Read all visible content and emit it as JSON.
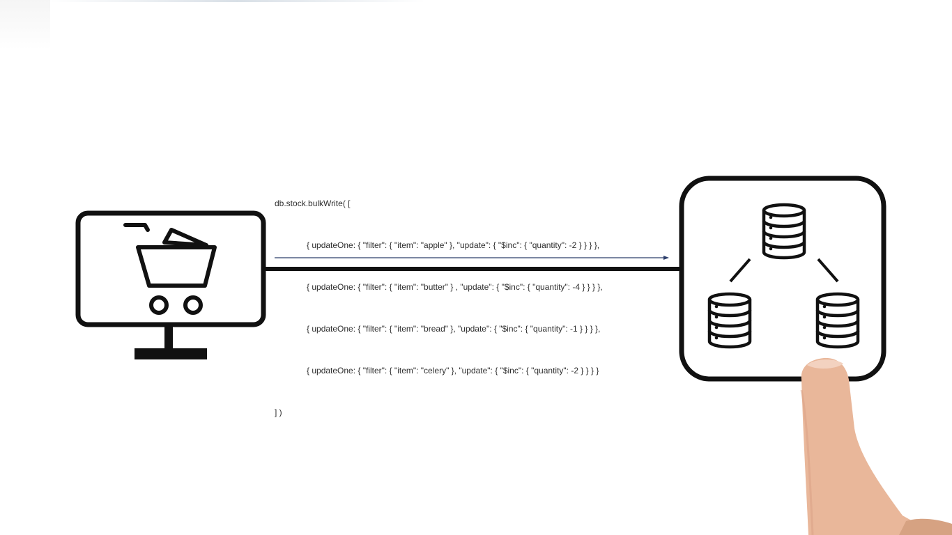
{
  "code": {
    "open": "db.stock.bulkWrite( [",
    "lines": [
      "{ updateOne: { \"filter\": { \"item\": \"apple\" }, \"update\": { \"$inc\": { \"quantity\": -2 } } } },",
      "{ updateOne: { \"filter\": { \"item\": \"butter\" } , \"update\": { \"$inc\": { \"quantity\": -4 } } } },",
      "{ updateOne: { \"filter\": { \"item\": \"bread\" }, \"update\": { \"$inc\": { \"quantity\": -1 } } } },",
      "{ updateOne: { \"filter\": { \"item\": \"celery\" }, \"update\": { \"$inc\": { \"quantity\": -2 } } } }"
    ],
    "close": "] )"
  },
  "icons": {
    "client": "shopping-cart-monitor-icon",
    "server": "database-cluster-icon",
    "hand": "pointing-finger"
  },
  "colors": {
    "stroke": "#111111",
    "arrow": "#2c3e6b",
    "text": "#2e2e2e",
    "skin": "#e9b79a"
  }
}
